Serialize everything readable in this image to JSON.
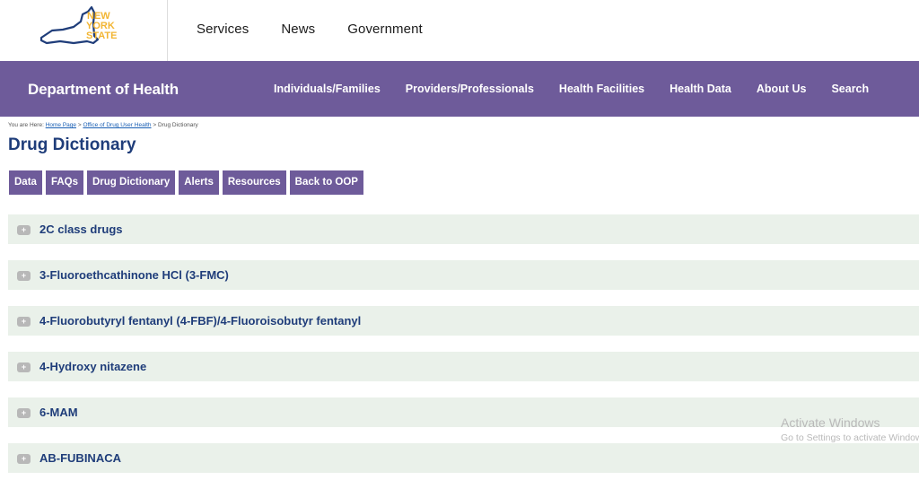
{
  "logo": {
    "line1": "NEW",
    "line2": "YORK",
    "line3": "STATE"
  },
  "top_nav": [
    "Services",
    "News",
    "Government"
  ],
  "agency": {
    "title": "Department of Health",
    "nav": [
      "Individuals/Families",
      "Providers/Professionals",
      "Health Facilities",
      "Health Data",
      "About Us",
      "Search"
    ]
  },
  "breadcrumb": {
    "prefix": "You are Here:",
    "home": "Home Page",
    "sep1": ">",
    "office": "Office of Drug User Health",
    "sep2": ">",
    "current": "Drug Dictionary"
  },
  "page_title": "Drug Dictionary",
  "tabs": [
    "Data",
    "FAQs",
    "Drug Dictionary",
    "Alerts",
    "Resources",
    "Back to OOP"
  ],
  "accordion": {
    "toggle_symbol": "+",
    "items": [
      "2C class drugs",
      "3-Fluoroethcathinone HCl (3-FMC)",
      "4-Fluorobutyryl fentanyl (4-FBF)/4-Fluoroisobutyr fentanyl",
      "4-Hydroxy nitazene",
      "6-MAM",
      "AB-FUBINACA"
    ]
  },
  "watermark": {
    "line1": "Activate Windows",
    "line2": "Go to Settings to activate Windows."
  },
  "colors": {
    "purple": "#6e5b9a",
    "navy": "#1f3d7a",
    "accordion_bg": "#eaf1ea",
    "logo_gold": "#f2b533"
  }
}
